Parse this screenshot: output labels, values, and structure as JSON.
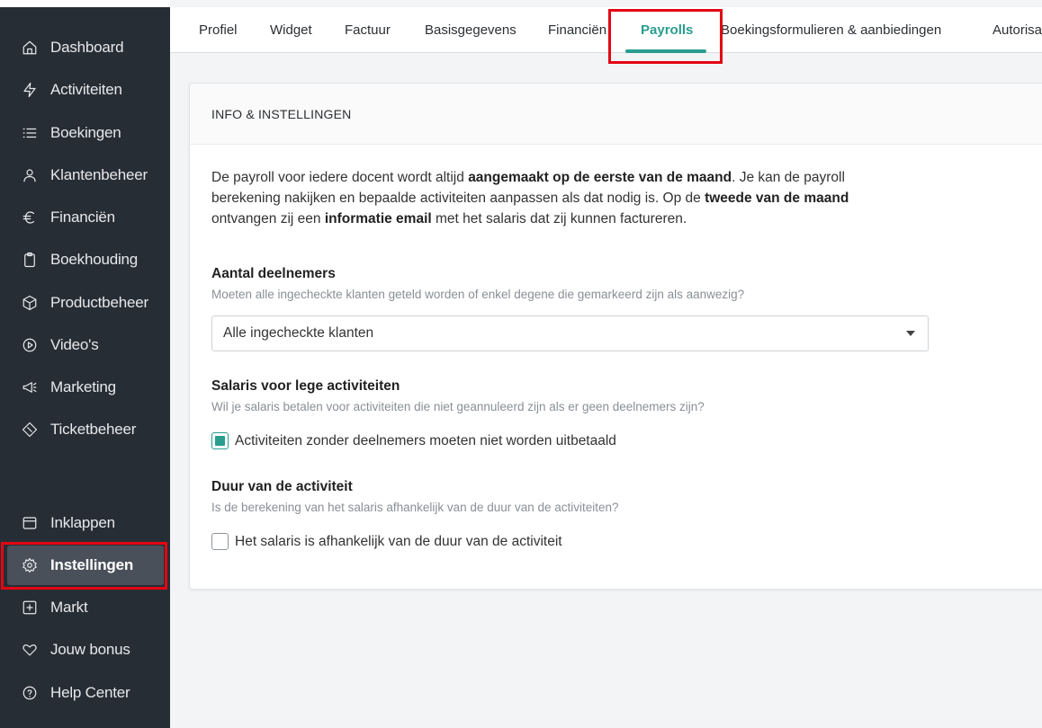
{
  "sidebar": {
    "items": [
      {
        "label": "Dashboard",
        "icon": "home-icon"
      },
      {
        "label": "Activiteiten",
        "icon": "lightning-icon"
      },
      {
        "label": "Boekingen",
        "icon": "list-icon"
      },
      {
        "label": "Klantenbeheer",
        "icon": "user-icon"
      },
      {
        "label": "Financiën",
        "icon": "euro-icon"
      },
      {
        "label": "Boekhouding",
        "icon": "clipboard-icon"
      },
      {
        "label": "Productbeheer",
        "icon": "box-icon"
      },
      {
        "label": "Video's",
        "icon": "play-circle-icon"
      },
      {
        "label": "Marketing",
        "icon": "megaphone-icon"
      },
      {
        "label": "Ticketbeheer",
        "icon": "ticket-icon"
      }
    ],
    "bottom_items": [
      {
        "label": "Inklappen",
        "icon": "collapse-icon"
      },
      {
        "label": "Instellingen",
        "icon": "gear-icon",
        "active": true
      },
      {
        "label": "Markt",
        "icon": "plus-square-icon"
      },
      {
        "label": "Jouw bonus",
        "icon": "heart-icon"
      },
      {
        "label": "Help Center",
        "icon": "help-icon"
      }
    ]
  },
  "tabs": [
    {
      "label": "Profiel"
    },
    {
      "label": "Widget"
    },
    {
      "label": "Factuur"
    },
    {
      "label": "Basisgegevens"
    },
    {
      "label": "Financiën"
    },
    {
      "label": "Payrolls",
      "active": true
    },
    {
      "label": "Boekingsformulieren & aanbiedingen"
    },
    {
      "label": "Autorisa"
    }
  ],
  "card": {
    "header": "INFO & INSTELLINGEN",
    "intro": {
      "p1": "De payroll voor iedere docent wordt altijd ",
      "b1": "aangemaakt op de eerste van de maand",
      "p2": ". Je kan de payroll berekening nakijken en bepaalde activiteiten aanpassen als dat nodig is. Op de ",
      "b2": "tweede van de maand",
      "p3": " ontvangen zij een ",
      "b3": "informatie email",
      "p4": " met het salaris dat zij kunnen factureren."
    },
    "participants": {
      "title": "Aantal deelnemers",
      "desc": "Moeten alle ingecheckte klanten geteld worden of enkel degene die gemarkeerd zijn als aanwezig?",
      "selected": "Alle ingecheckte klanten"
    },
    "empty_activities": {
      "title": "Salaris voor lege activiteiten",
      "desc": "Wil je salaris betalen voor activiteiten die niet geannuleerd zijn als er geen deelnemers zijn?",
      "checkbox_label": "Activiteiten zonder deelnemers moeten niet worden uitbetaald",
      "checked": true
    },
    "duration": {
      "title": "Duur van de activiteit",
      "desc": "Is de berekening van het salaris afhankelijk van de duur van de activiteiten?",
      "checkbox_label": "Het salaris is afhankelijk van de duur van de activiteit",
      "checked": false
    }
  },
  "colors": {
    "sidebar_bg": "#272d35",
    "accent": "#2a9d8f",
    "highlight": "#e30613"
  }
}
